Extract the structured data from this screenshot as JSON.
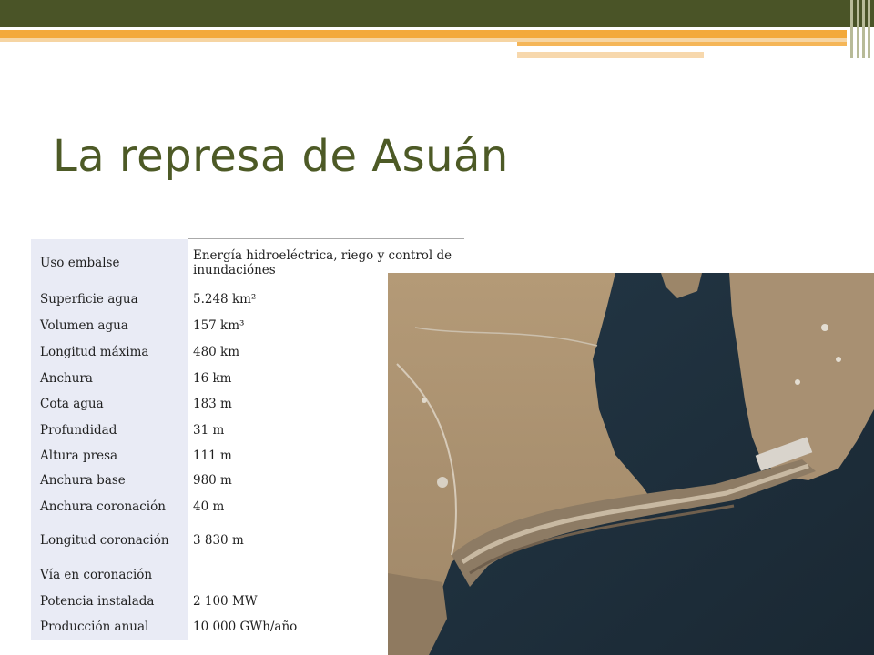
{
  "slide": {
    "title": "La represa de Asuán"
  },
  "table": {
    "rows": [
      {
        "label": "Uso embalse",
        "value": "Energía hidroeléctrica, riego y control de inundaciónes"
      },
      {
        "label": "Superficie agua",
        "value": "5.248 km²"
      },
      {
        "label": "Volumen agua",
        "value": "157 km³"
      },
      {
        "label": "Longitud máxima",
        "value": "480 km"
      },
      {
        "label": "Anchura",
        "value": "16 km"
      },
      {
        "label": "Cota agua",
        "value": "183 m"
      },
      {
        "label": "Profundidad",
        "value": "31 m"
      },
      {
        "label": "Altura presa",
        "value": "111 m"
      },
      {
        "label": "Anchura base",
        "value": "980 m"
      },
      {
        "label": "Anchura coronación",
        "value": "40 m"
      },
      {
        "label": "Longitud coronación",
        "value": "3 830 m"
      },
      {
        "label": "Vía en coronación",
        "value": ""
      },
      {
        "label": "Potencia instalada",
        "value": "2 100 MW"
      },
      {
        "label": "Producción anual",
        "value": "10 000 GWh/año"
      }
    ]
  },
  "colors": {
    "title": "#4d5a26",
    "top_bar": "#4a5427",
    "accent_orange": "#f3a93b",
    "label_cell": "#e9ebf5"
  }
}
